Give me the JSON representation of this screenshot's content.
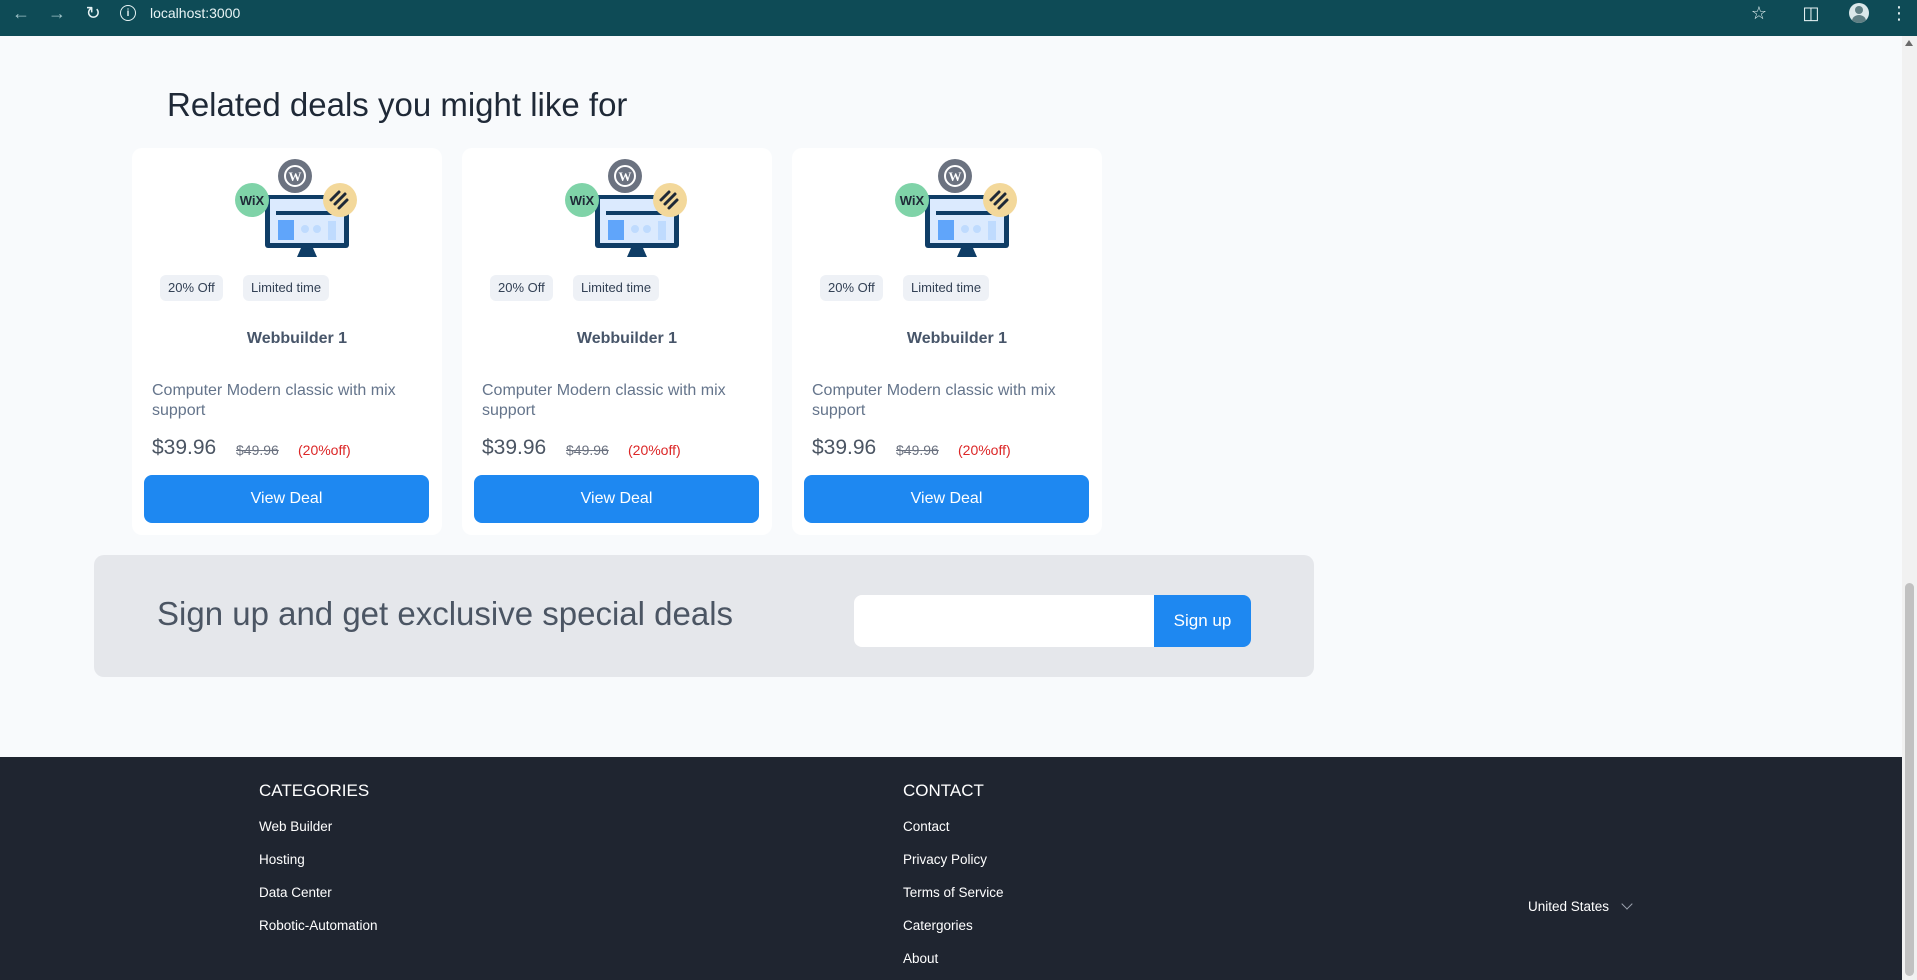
{
  "browser": {
    "url": "localhost:3000",
    "colors": {
      "chrome_bg": "#0e4b56"
    }
  },
  "related": {
    "title": "Related deals you might like for",
    "cards": [
      {
        "tag_discount": "20% Off",
        "tag_time": "Limited time",
        "title": "Webbuilder 1",
        "description": "Computer Modern classic with mix support",
        "price": "$39.96",
        "old_price": "$49.96",
        "discount": "(20%off)",
        "button": "View Deal"
      },
      {
        "tag_discount": "20% Off",
        "tag_time": "Limited time",
        "title": "Webbuilder 1",
        "description": "Computer Modern classic with mix support",
        "price": "$39.96",
        "old_price": "$49.96",
        "discount": "(20%off)",
        "button": "View Deal"
      },
      {
        "tag_discount": "20% Off",
        "tag_time": "Limited time",
        "title": "Webbuilder 1",
        "description": "Computer Modern classic with mix support",
        "price": "$39.96",
        "old_price": "$49.96",
        "discount": "(20%off)",
        "button": "View Deal"
      }
    ]
  },
  "signup": {
    "title": "Sign up and get exclusive special deals",
    "email_placeholder": "",
    "button": "Sign up",
    "colors": {
      "accent": "#1e88f1",
      "discount": "#dc2626"
    }
  },
  "footer": {
    "categories": {
      "heading": "CATEGORIES",
      "links": [
        "Web Builder",
        "Hosting",
        "Data Center",
        "Robotic-Automation"
      ]
    },
    "contact": {
      "heading": "CONTACT",
      "links": [
        "Contact",
        "Privacy Policy",
        "Terms of Service",
        "Catergories",
        "About"
      ]
    },
    "country": "United States",
    "colors": {
      "bg": "#1f2530"
    }
  }
}
